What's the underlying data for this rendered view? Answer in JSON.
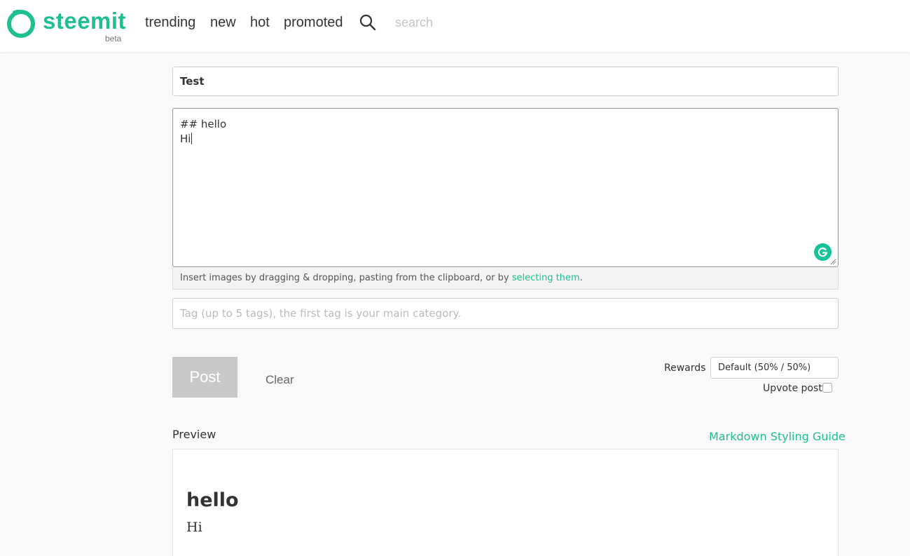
{
  "brand": {
    "name": "steemit",
    "tag": "beta",
    "accent_color": "#1fbf8f"
  },
  "nav": {
    "items": [
      "trending",
      "new",
      "hot",
      "promoted"
    ]
  },
  "search": {
    "placeholder": "search",
    "icon": "search-icon"
  },
  "editor": {
    "title_value": "Test",
    "body_line_1": "## hello",
    "body_line_2": "Hi",
    "grammarly_icon": "grammarly-icon",
    "hint_text": "Insert images by dragging & dropping, pasting from the clipboard, or by ",
    "hint_link": "selecting them",
    "hint_suffix": ".",
    "tags_placeholder": "Tag (up to 5 tags), the first tag is your main category."
  },
  "actions": {
    "post_label": "Post",
    "clear_label": "Clear",
    "rewards_label": "Rewards",
    "rewards_value": "Default (50% / 50%)",
    "upvote_label": "Upvote post",
    "upvote_checked": false
  },
  "preview": {
    "label": "Preview",
    "guide_link": "Markdown Styling Guide",
    "heading": "hello",
    "paragraph": "Hi"
  }
}
